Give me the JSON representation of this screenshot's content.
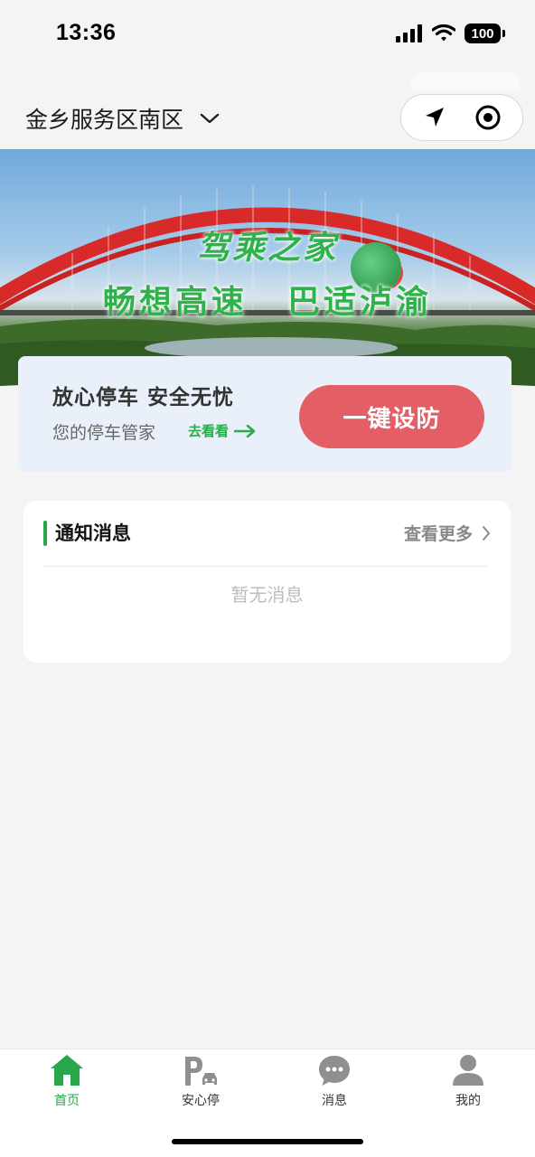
{
  "status_bar": {
    "time": "13:36",
    "battery": "100"
  },
  "header": {
    "location": "金乡服务区南区"
  },
  "banner": {
    "title": "驾乘之家",
    "slogan_left": "畅想高速",
    "slogan_right": "巴适泸渝"
  },
  "guard": {
    "title": "放心停车  安全无忧",
    "subtitle": "您的停车管家",
    "link": "去看看",
    "button": "一键设防"
  },
  "notice": {
    "title": "通知消息",
    "more": "查看更多",
    "empty": "暂无消息"
  },
  "tabs": [
    {
      "label": "首页",
      "icon": "home-icon"
    },
    {
      "label": "安心停",
      "icon": "parking-icon"
    },
    {
      "label": "消息",
      "icon": "message-icon"
    },
    {
      "label": "我的",
      "icon": "user-icon"
    }
  ],
  "colors": {
    "accent": "#27a64a",
    "guard_button": "#e45e66",
    "card_bg": "#e9f0f9"
  }
}
